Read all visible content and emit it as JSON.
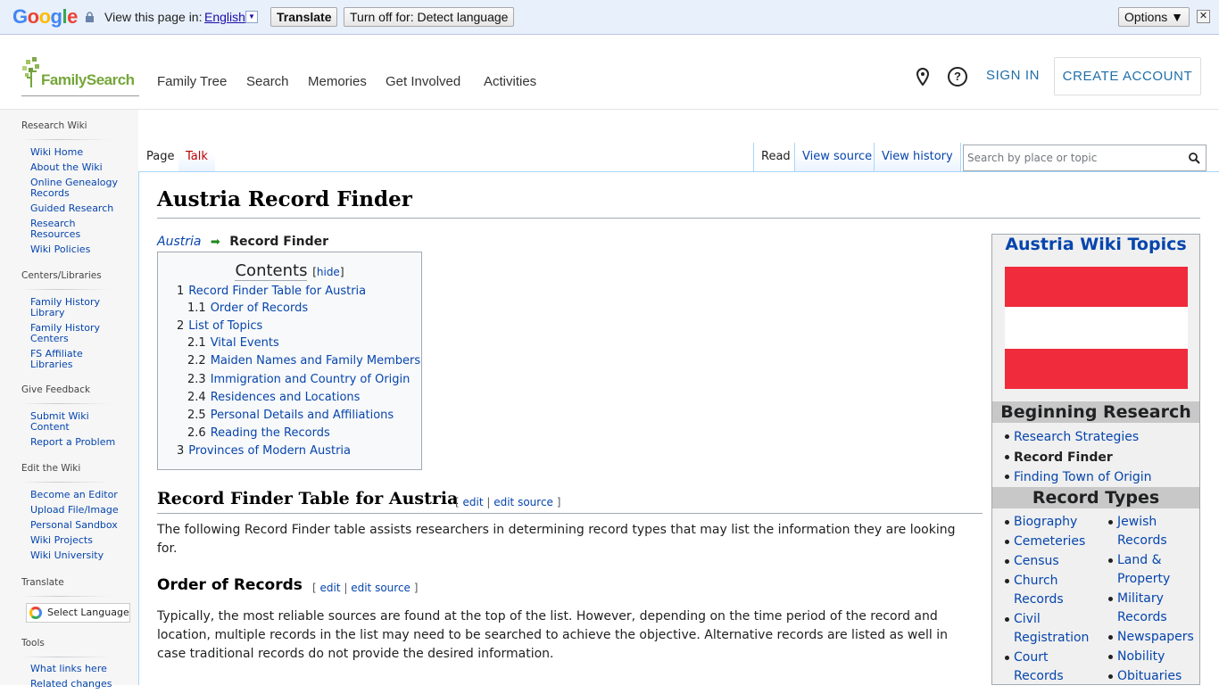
{
  "gtranslate": {
    "logo": "Google",
    "view_text": "View this page in:",
    "language": "English",
    "translate_btn": "Translate",
    "turnoff_btn": "Turn off for: Detect language",
    "options_btn": "Options ▼",
    "close": "✕"
  },
  "header": {
    "logo_text": "FamilySearch",
    "nav": [
      "Family Tree",
      "Search",
      "Memories",
      "Get Involved",
      "Activities"
    ],
    "sign_in": "SIGN IN",
    "create_account": "CREATE ACCOUNT",
    "help_glyph": "?"
  },
  "sidebar": {
    "sections": [
      {
        "title": "Research Wiki",
        "items": [
          "Wiki Home",
          "About the Wiki",
          "Online Genealogy Records",
          "Guided Research",
          "Research Resources",
          "Wiki Policies"
        ]
      },
      {
        "title": "Centers/Libraries",
        "items": [
          "Family History Library",
          "Family History Centers",
          "FS Affiliate Libraries"
        ]
      },
      {
        "title": "Give Feedback",
        "items": [
          "Submit Wiki Content",
          "Report a Problem"
        ]
      },
      {
        "title": "Edit the Wiki",
        "items": [
          "Become an Editor",
          "Upload File/Image",
          "Personal Sandbox",
          "Wiki Projects",
          "Wiki University"
        ]
      },
      {
        "title": "Translate",
        "items": []
      },
      {
        "title": "Tools",
        "items": [
          "What links here",
          "Related changes"
        ]
      }
    ],
    "select_language": "Select Language"
  },
  "tabs": {
    "page": "Page",
    "talk": "Talk",
    "read": "Read",
    "view_source": "View source",
    "view_history": "View history",
    "search_placeholder": "Search by place or topic"
  },
  "article": {
    "title": "Austria Record Finder",
    "crumb_link": "Austria",
    "crumb_current": "Record Finder",
    "toc": {
      "title": "Contents",
      "hide": "hide",
      "items": [
        {
          "num": "1",
          "text": "Record Finder Table for Austria"
        },
        {
          "num": "1.1",
          "text": "Order of Records"
        },
        {
          "num": "2",
          "text": "List of Topics"
        },
        {
          "num": "2.1",
          "text": "Vital Events"
        },
        {
          "num": "2.2",
          "text": "Maiden Names and Family Members"
        },
        {
          "num": "2.3",
          "text": "Immigration and Country of Origin"
        },
        {
          "num": "2.4",
          "text": "Residences and Locations"
        },
        {
          "num": "2.5",
          "text": "Personal Details and Affiliations"
        },
        {
          "num": "2.6",
          "text": "Reading the Records"
        },
        {
          "num": "3",
          "text": "Provinces of Modern Austria"
        }
      ]
    },
    "h2": "Record Finder Table for Austria",
    "edit": "edit",
    "edit_source": "edit source",
    "p1_line1": "The following Record Finder table assists researchers in determining record types that may list the information they are looking",
    "p1_line2": "for.",
    "h3": "Order of Records",
    "p2_line1": "Typically, the most reliable sources are found at the top of the list. However, depending on the time period of the record and",
    "p2_line2": "location, multiple records in the list may need to be searched to achieve the objective. Alternative records are listed as well in",
    "p2_line3": "case traditional records do not provide the desired information."
  },
  "infobox": {
    "title": "Austria Wiki Topics",
    "flag_colors": [
      "#ef2b3c",
      "#ffffff",
      "#ef2b3c"
    ],
    "beginning_header": "Beginning Research",
    "beginning": [
      "Research Strategies",
      "Record Finder",
      "Finding Town of Origin"
    ],
    "record_types_header": "Record Types",
    "col1": [
      [
        "Biography"
      ],
      [
        "Cemeteries"
      ],
      [
        "Census"
      ],
      [
        "Church",
        "Records"
      ],
      [
        "Civil",
        "Registration"
      ],
      [
        "Court",
        "Records"
      ]
    ],
    "col2": [
      [
        "Jewish",
        "Records"
      ],
      [
        "Land &",
        "Property"
      ],
      [
        "Military",
        "Records"
      ],
      [
        "Newspapers"
      ],
      [
        "Nobility"
      ],
      [
        "Obituaries"
      ]
    ]
  }
}
